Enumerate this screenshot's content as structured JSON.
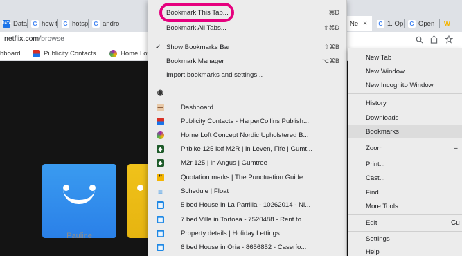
{
  "tabs": [
    {
      "label": "DataF",
      "fav": "DATA",
      "fav_color": "#1a73e8"
    },
    {
      "label": "how t",
      "fav": "G",
      "fav_color": "#ffffff"
    },
    {
      "label": "hotsp",
      "fav": "G",
      "fav_color": "#ffffff"
    },
    {
      "label": "andro",
      "fav": "G",
      "fav_color": "#ffffff"
    },
    {
      "label": "Ne",
      "fav": "N",
      "fav_color": "#e50914"
    },
    {
      "label": "1. Op",
      "fav": "G",
      "fav_color": "#ffffff"
    },
    {
      "label": "Open",
      "fav": "G",
      "fav_color": "#ffffff"
    },
    {
      "label": "",
      "fav": "W",
      "fav_color": "#f4b400"
    }
  ],
  "tab_close_glyph": "×",
  "address": {
    "host": "netflix.com",
    "path": "/browse"
  },
  "toolbar_icons": [
    "zoom-icon",
    "share-icon",
    "star-icon"
  ],
  "bookmarks_bar": [
    {
      "label": "hboard",
      "color": "#e8c9a8"
    },
    {
      "label": "Publicity Contacts...",
      "color": "#d93025"
    },
    {
      "label": "Home Lof",
      "color": "#9c27b0"
    }
  ],
  "bookmarks_menu": {
    "top_items": [
      {
        "label": "Bookmark This Tab...",
        "shortcut": "⌘D"
      },
      {
        "label": "Bookmark All Tabs...",
        "shortcut": "⇧⌘D"
      }
    ],
    "middle_items": [
      {
        "label": "Show Bookmarks Bar",
        "shortcut": "⇧⌘B",
        "checked": "✓"
      },
      {
        "label": "Bookmark Manager",
        "shortcut": "⌥⌘B"
      },
      {
        "label": "Import bookmarks and settings..."
      }
    ],
    "bookmarks": [
      {
        "label": "",
        "color": "#555555",
        "glyph": "◉"
      },
      {
        "label": "Dashboard",
        "color": "#e8c9a8",
        "glyph": "—"
      },
      {
        "label": "Publicity Contacts - HarperCollins Publish...",
        "color": "#d93025",
        "glyph": "≡"
      },
      {
        "label": "Home Loft Concept Nordic Upholstered B...",
        "color": "#9c27b0",
        "glyph": "✱"
      },
      {
        "label": "Pitbike 125 kxf M2R | in Leven, Fife | Gumt...",
        "color": "#2e7d32",
        "glyph": "◆"
      },
      {
        "label": "M2r 125 | in Angus | Gumtree",
        "color": "#2e7d32",
        "glyph": "◆"
      },
      {
        "label": "Quotation marks | The Punctuation Guide",
        "color": "#f4b400",
        "glyph": "”"
      },
      {
        "label": "Schedule | Float",
        "color": "#1e88e5",
        "glyph": "≡"
      },
      {
        "label": "5 bed House in La Parrilla - 10262014 - Ni...",
        "color": "#1e88e5",
        "glyph": "▦"
      },
      {
        "label": "7 bed Villa in Tortosa - 7520488 - Rent to...",
        "color": "#1e88e5",
        "glyph": "▦"
      },
      {
        "label": "Property details | Holiday Lettings",
        "color": "#1e88e5",
        "glyph": "▦"
      },
      {
        "label": "6 bed House in Oria - 8656852 - Caserío...",
        "color": "#1e88e5",
        "glyph": "▦"
      }
    ]
  },
  "chrome_menu": [
    {
      "label": "New Tab"
    },
    {
      "label": "New Window"
    },
    {
      "label": "New Incognito Window"
    },
    {
      "label": "History"
    },
    {
      "label": "Downloads"
    },
    {
      "label": "Bookmarks",
      "selected": true
    },
    {
      "label": "Zoom",
      "aux": "–"
    },
    {
      "label": "Print..."
    },
    {
      "label": "Cast..."
    },
    {
      "label": "Find..."
    },
    {
      "label": "More Tools"
    },
    {
      "label": "Edit",
      "aux": "Cu"
    },
    {
      "label": "Settings"
    },
    {
      "label": "Help"
    }
  ],
  "profiles": [
    {
      "name": "Pauline",
      "color": "#2d8cee"
    },
    {
      "name": "",
      "color": "#f0c21a"
    }
  ],
  "highlight_color": "#e6007e"
}
